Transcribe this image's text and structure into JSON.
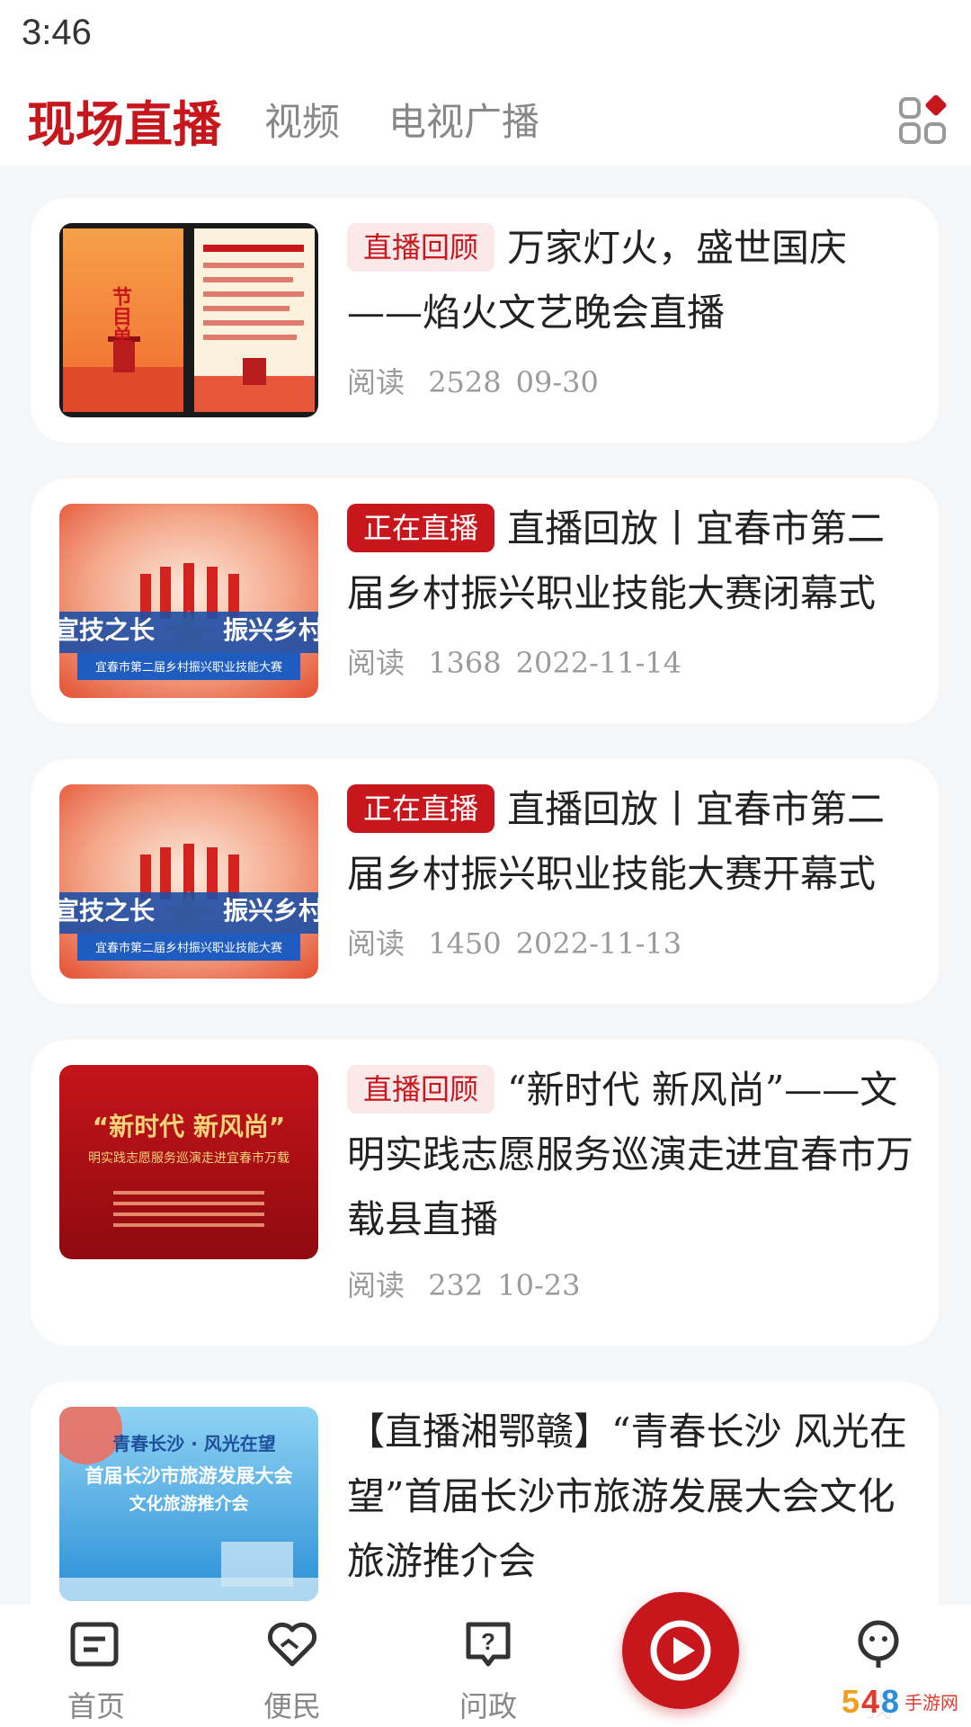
{
  "status_bar": {
    "time": "3:46"
  },
  "top_nav": {
    "tabs": [
      {
        "label": "现场直播"
      },
      {
        "label": "视频"
      },
      {
        "label": "电视广播"
      }
    ]
  },
  "feed": [
    {
      "badge": "直播回顾",
      "title": "万家灯火，盛世国庆——焰火文艺晚会直播",
      "reads_label": "阅读",
      "reads": "2528",
      "date": "09-30",
      "thumb_text": [
        "节",
        "目",
        "单"
      ]
    },
    {
      "badge": "正在直播",
      "title": "直播回放丨宜春市第二届乡村振兴职业技能大赛闭幕式",
      "reads_label": "阅读",
      "reads": "1368",
      "date": "2022-11-14",
      "thumb_text": [
        "宣技之长",
        "振兴乡村",
        "宜春市第二届乡村振兴职业技能大赛"
      ]
    },
    {
      "badge": "正在直播",
      "title": "直播回放丨宜春市第二届乡村振兴职业技能大赛开幕式",
      "reads_label": "阅读",
      "reads": "1450",
      "date": "2022-11-13",
      "thumb_text": [
        "宣技之长",
        "振兴乡村",
        "宜春市第二届乡村振兴职业技能大赛"
      ]
    },
    {
      "badge": "直播回顾",
      "title": "“新时代 新风尚”——文明实践志愿服务巡演走进宜春市万载县直播",
      "reads_label": "阅读",
      "reads": "232",
      "date": "10-23",
      "thumb_text": [
        "“新时代  新风尚”",
        "明实践志愿服务巡演走进宜春市万载"
      ]
    },
    {
      "badge": "",
      "title": "【直播湘鄂赣】“青春长沙  风光在望”首届长沙市旅游发展大会文化旅游推介会",
      "thumb_text": [
        "青春长沙 · 风光在望",
        "首届长沙市旅游发展大会",
        "文化旅游推介会"
      ]
    }
  ],
  "bottom_nav": {
    "items": [
      {
        "label": "首页"
      },
      {
        "label": "便民"
      },
      {
        "label": "问政"
      },
      {
        "label": "我"
      }
    ]
  },
  "colors": {
    "accent": "#c8161d",
    "badge_bg_light": "#fbe9ea",
    "page_bg": "#f5f6f8"
  },
  "watermark": {
    "text": "手游网"
  }
}
